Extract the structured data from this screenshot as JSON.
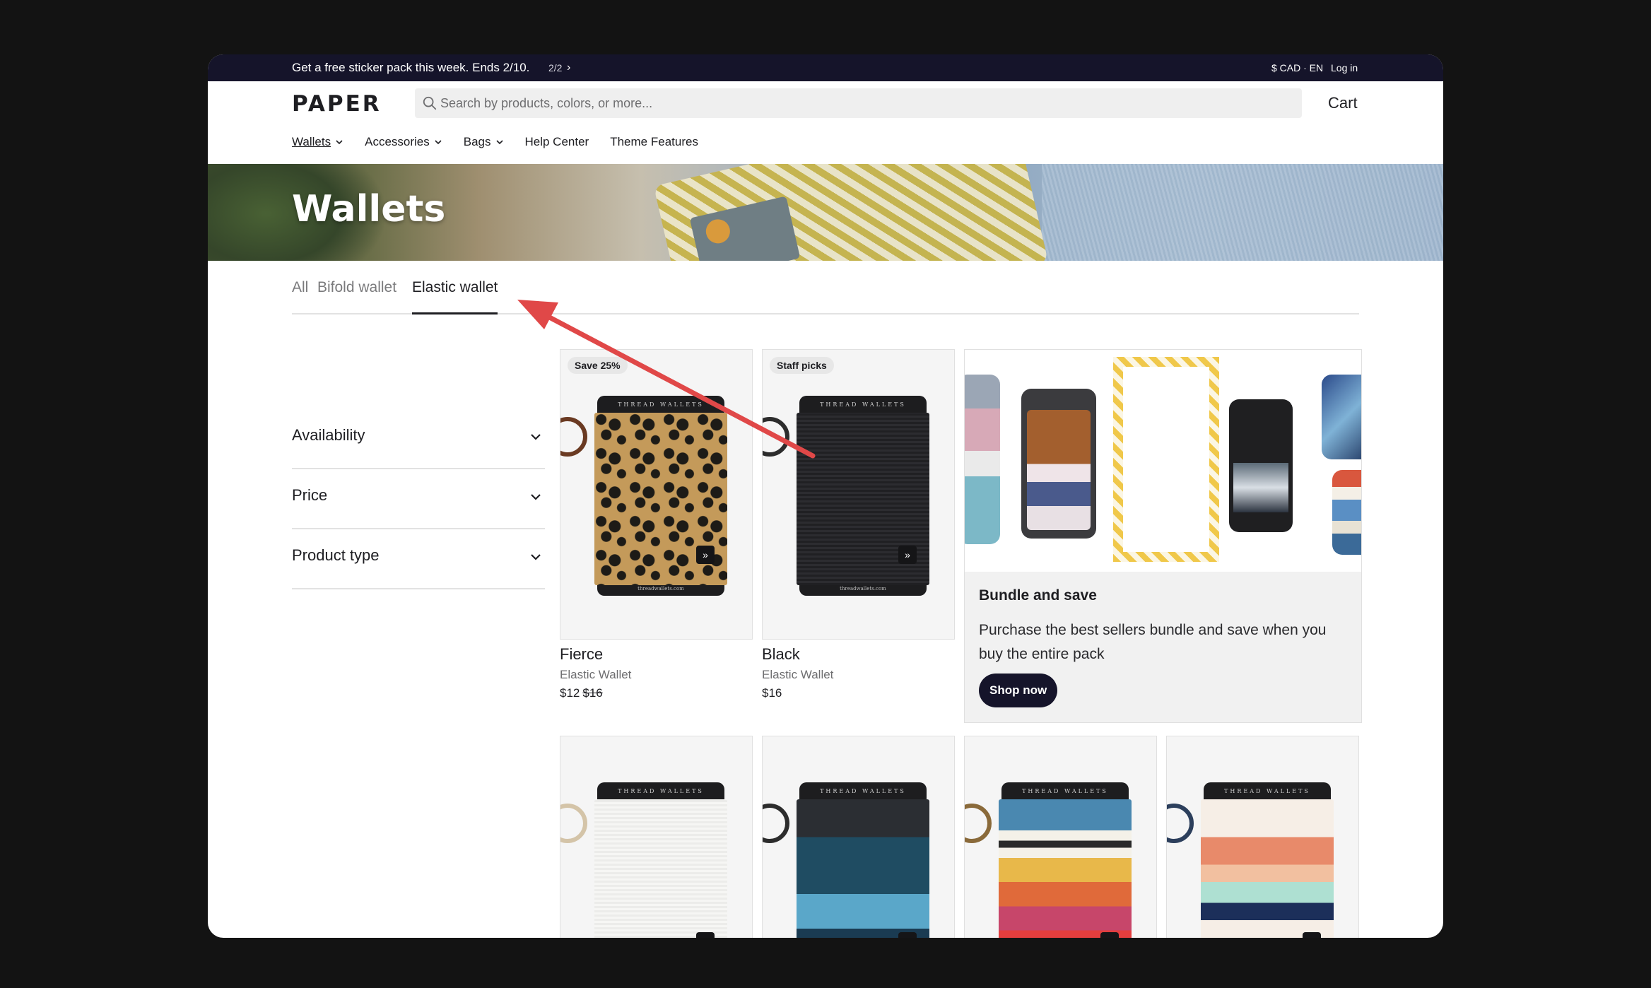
{
  "announcement": {
    "message": "Get a free sticker pack this week. Ends 2/10.",
    "pager": "2/2",
    "currency": "$ CAD · EN",
    "login": "Log in"
  },
  "header": {
    "logo": "PAPER",
    "search_placeholder": "Search by products, colors, or more...",
    "cart": "Cart"
  },
  "nav": [
    {
      "label": "Wallets",
      "active": true,
      "has_menu": true
    },
    {
      "label": "Accessories",
      "has_menu": true
    },
    {
      "label": "Bags",
      "has_menu": true
    },
    {
      "label": "Help Center",
      "has_menu": false
    },
    {
      "label": "Theme Features",
      "has_menu": false
    }
  ],
  "hero": {
    "title": "Wallets"
  },
  "tabs": [
    {
      "label": "All",
      "active": false
    },
    {
      "label": "Bifold wallet",
      "active": false
    },
    {
      "label": "Elastic wallet",
      "active": true
    }
  ],
  "filters": [
    {
      "label": "Availability"
    },
    {
      "label": "Price"
    },
    {
      "label": "Product type"
    }
  ],
  "products": [
    {
      "badge": "Save 25%",
      "brand": "THREAD WALLETS",
      "url": "threadwallets.com",
      "name": "Fierce",
      "type": "Elastic Wallet",
      "price": "$12",
      "compare_price": "$16"
    },
    {
      "badge": "Staff picks",
      "brand": "THREAD WALLETS",
      "url": "threadwallets.com",
      "name": "Black",
      "type": "Elastic Wallet",
      "price": "$16"
    }
  ],
  "row2_products": [
    {
      "brand": "THREAD WALLETS"
    },
    {
      "brand": "THREAD WALLETS"
    },
    {
      "brand": "THREAD WALLETS"
    },
    {
      "brand": "THREAD WALLETS"
    }
  ],
  "promo": {
    "title": "Bundle and save",
    "text": "Purchase the best sellers bundle and save when you buy the entire pack",
    "button": "Shop now"
  },
  "colors": {
    "announce_bg": "#15142a",
    "button_bg": "#15142a",
    "annotation_arrow": "#e04848",
    "page_bg": "#131313"
  }
}
